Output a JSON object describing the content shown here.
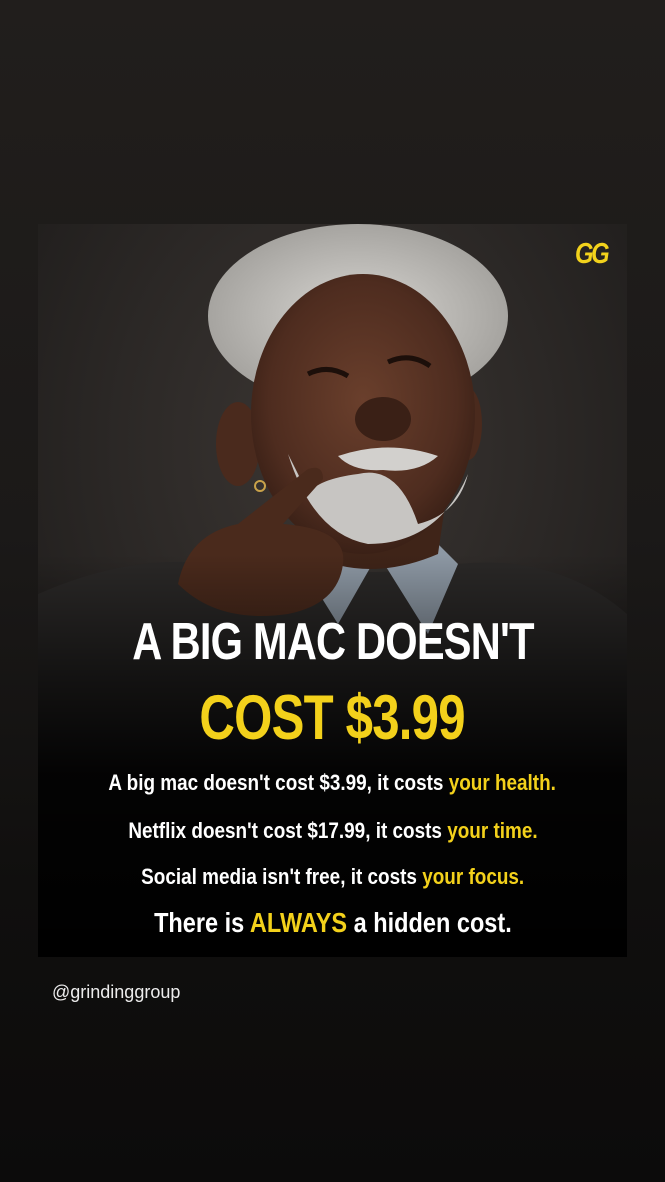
{
  "post": {
    "logo": "GG",
    "headline_line1": "A BIG MAC DOESN'T",
    "headline_line2": "COST $3.99",
    "lines": [
      {
        "text": "A big mac doesn't cost $3.99, it costs ",
        "highlight": "your health."
      },
      {
        "text": "Netflix doesn't cost $17.99, it costs ",
        "highlight": "your time."
      },
      {
        "text": "Social media isn't free, it costs ",
        "highlight": "your focus."
      }
    ],
    "closing": {
      "before": "There is ",
      "highlight": "ALWAYS",
      "after": " a hidden cost."
    }
  },
  "handle": "@grindinggroup",
  "colors": {
    "accent": "#f3d11b",
    "text": "#ffffff",
    "background": "#1b1918"
  }
}
